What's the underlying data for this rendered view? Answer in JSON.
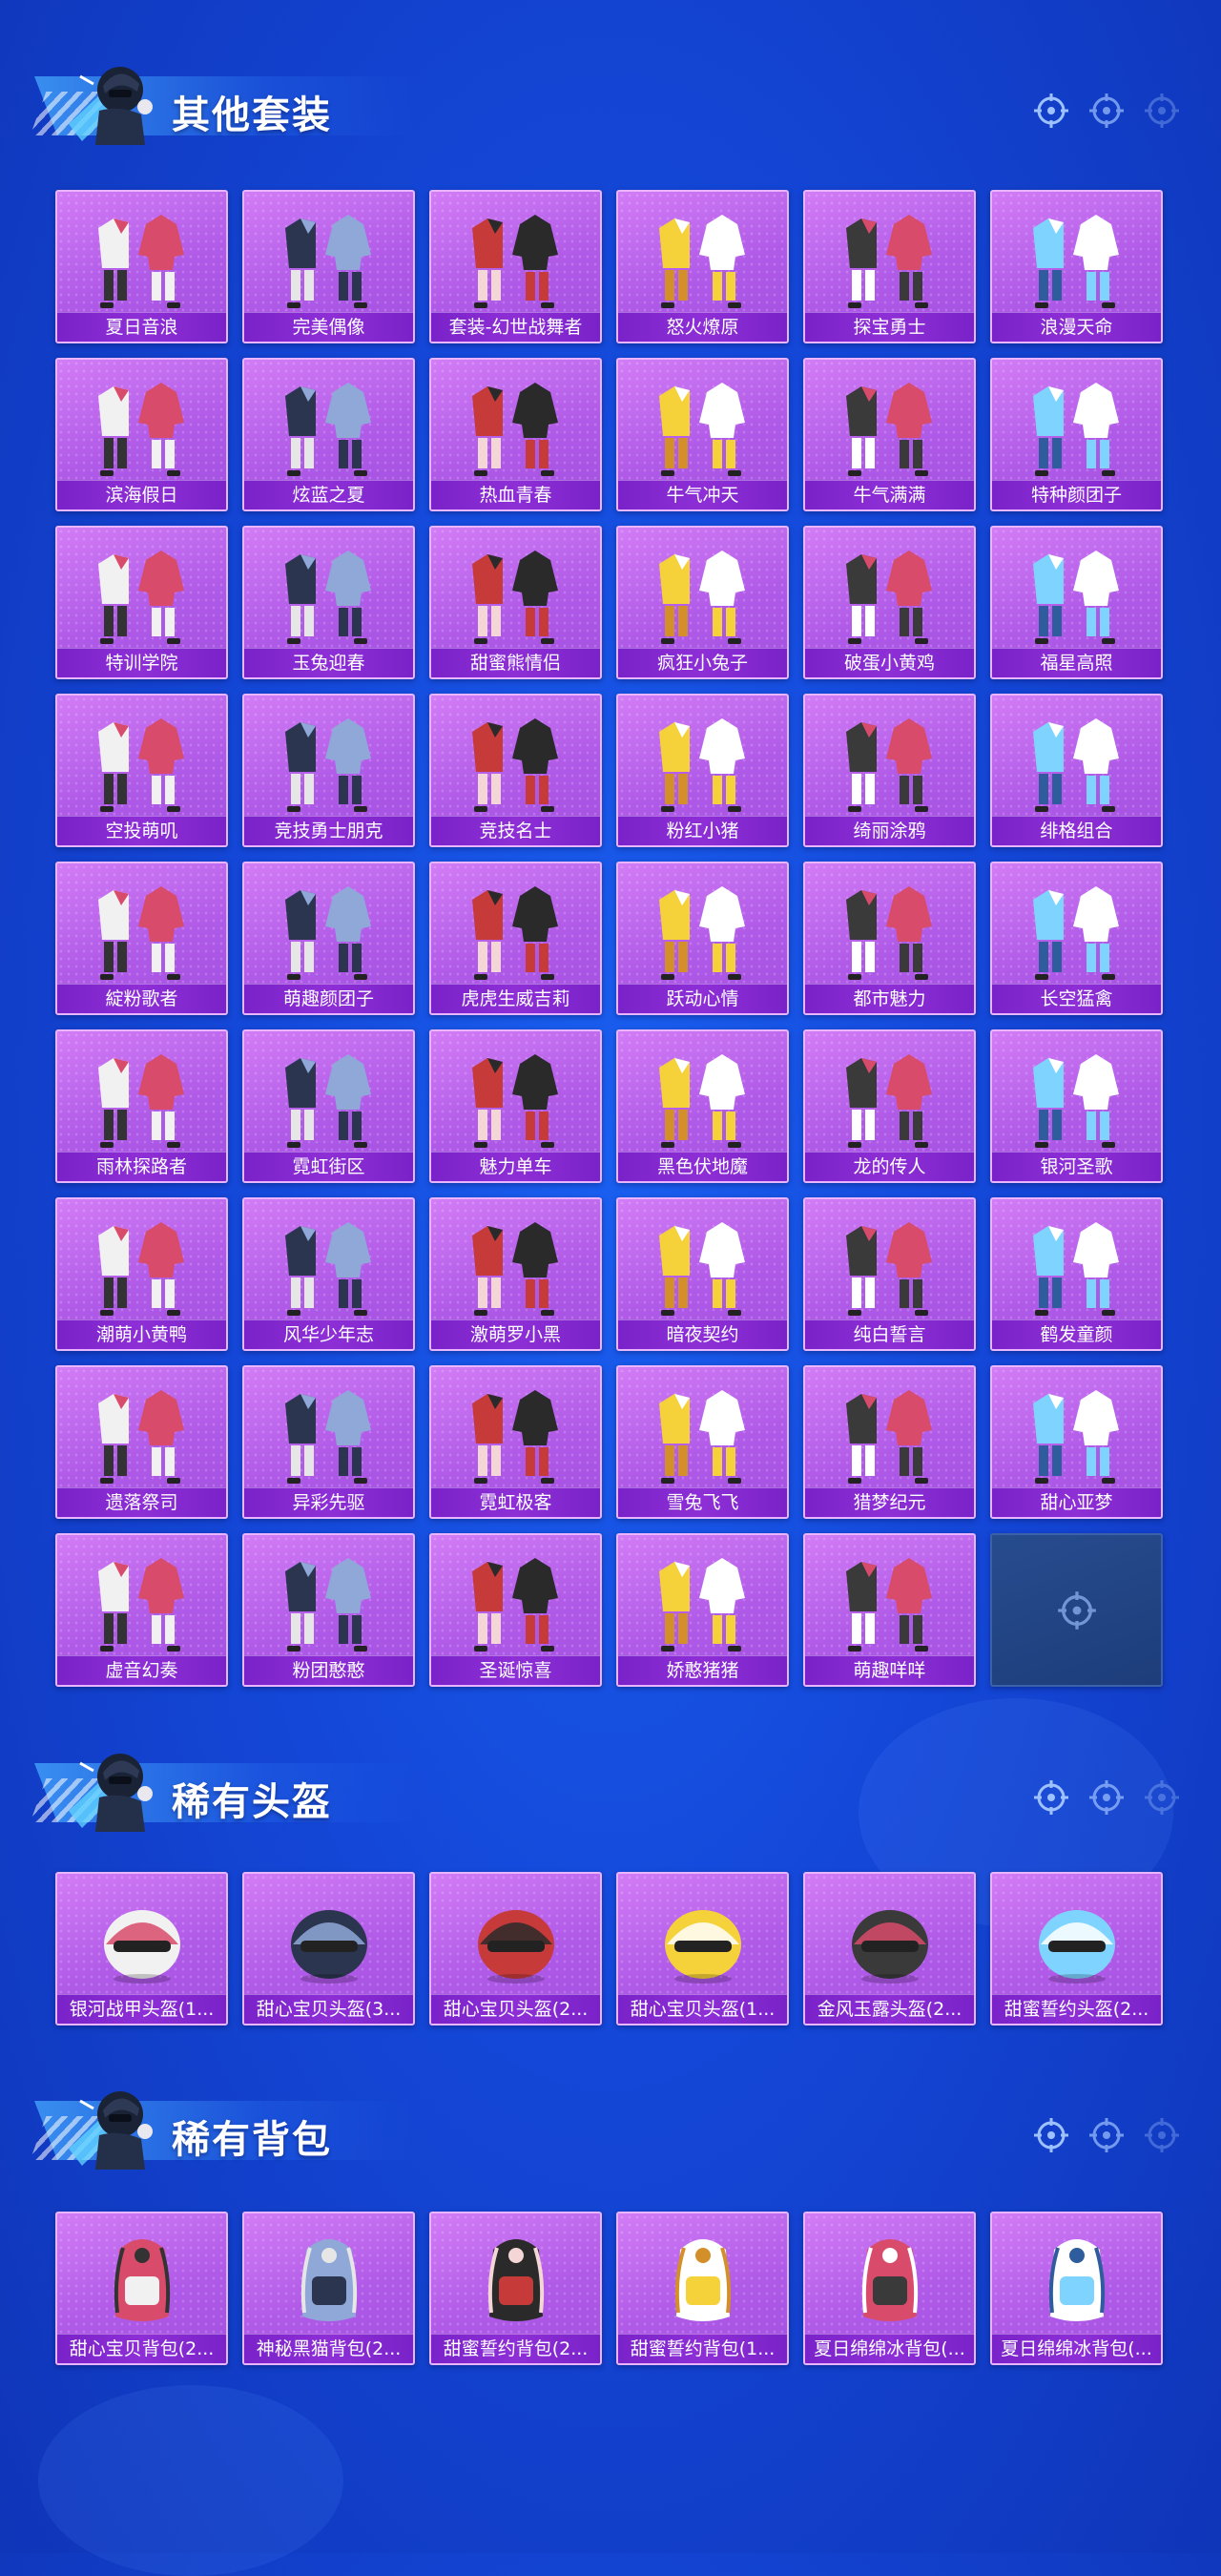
{
  "icons": {
    "section_mascot": "mascot-soldier-icon",
    "crosshair": "crosshair-icon"
  },
  "colors": {
    "background": "#1447d8",
    "card": "#b05ae8",
    "label_bar": "#7a22c9",
    "empty_card": "#1d3d7a"
  },
  "sections": [
    {
      "title": "其他套装",
      "items": [
        "夏日音浪",
        "完美偶像",
        "套装-幻世战舞者",
        "怒火燎原",
        "探宝勇士",
        "浪漫天命",
        "滨海假日",
        "炫蓝之夏",
        "热血青春",
        "牛气冲天",
        "牛气满满",
        "特种颜团子",
        "特训学院",
        "玉兔迎春",
        "甜蜜熊情侣",
        "疯狂小兔子",
        "破蛋小黄鸡",
        "福星高照",
        "空投萌叽",
        "竞技勇士朋克",
        "竞技名士",
        "粉红小猪",
        "绮丽涂鸦",
        "绯格组合",
        "綻粉歌者",
        "萌趣颜团子",
        "虎虎生威吉莉",
        "跃动心情",
        "都市魅力",
        "长空猛禽",
        "雨林探路者",
        "霓虹街区",
        "魅力单车",
        "黑色伏地魔",
        "龙的传人",
        "银河圣歌",
        "潮萌小黄鸭",
        "风华少年志",
        "激萌罗小黑",
        "暗夜契约",
        "纯白誓言",
        "鹤发童颜",
        "遗落祭司",
        "异彩先驱",
        "霓虹极客",
        "雪兔飞飞",
        "猎梦纪元",
        "甜心亚梦",
        "虚音幻奏",
        "粉团憨憨",
        "圣诞惊喜",
        "娇憨猪猪",
        "萌趣咩咩"
      ]
    },
    {
      "title": "稀有头盔",
      "items": [
        "银河战甲头盔(1...",
        "甜心宝贝头盔(3...",
        "甜心宝贝头盔(2...",
        "甜心宝贝头盔(1...",
        "金风玉露头盔(2...",
        "甜蜜誓约头盔(2..."
      ]
    },
    {
      "title": "稀有背包",
      "items": [
        "甜心宝贝背包(2...",
        "神秘黑猫背包(2...",
        "甜蜜誓约背包(2...",
        "甜蜜誓约背包(1...",
        "夏日绵绵冰背包(...",
        "夏日绵绵冰背包(..."
      ]
    }
  ]
}
